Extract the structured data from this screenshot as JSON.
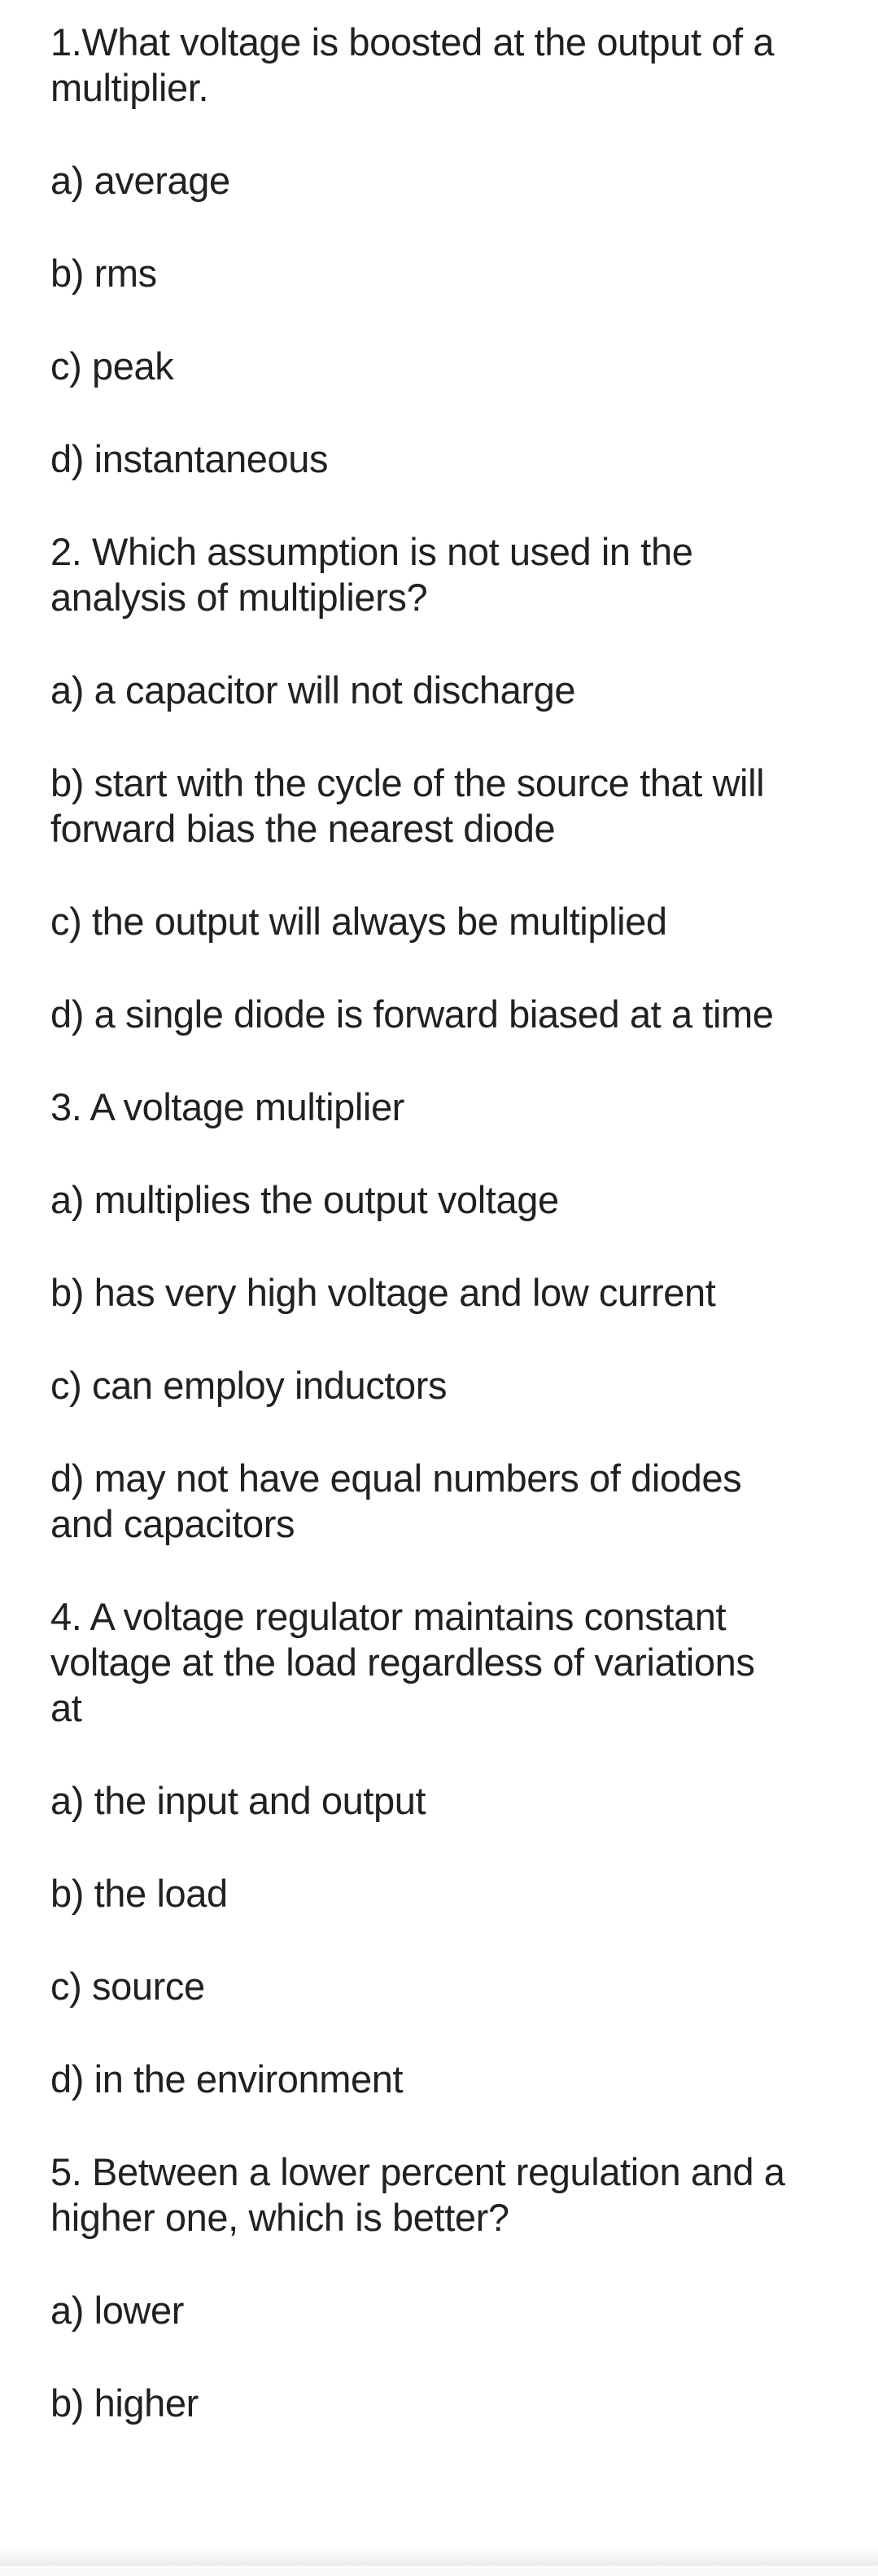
{
  "questions": [
    {
      "number": "1",
      "question_lines": [
        "1.What voltage is boosted at the output of a",
        "multiplier."
      ],
      "options": [
        {
          "letter": "a",
          "lines": [
            "a) average"
          ]
        },
        {
          "letter": "b",
          "lines": [
            "b) rms"
          ]
        },
        {
          "letter": "c",
          "lines": [
            "c) peak"
          ]
        },
        {
          "letter": "d",
          "lines": [
            "d) instantaneous"
          ]
        }
      ]
    },
    {
      "number": "2",
      "question_lines": [
        "2. Which assumption is not used in the",
        "analysis of multipliers?"
      ],
      "options": [
        {
          "letter": "a",
          "lines": [
            "a) a capacitor will not discharge"
          ]
        },
        {
          "letter": "b",
          "lines": [
            "b) start with the cycle of the source that will",
            "forward bias the nearest diode"
          ]
        },
        {
          "letter": "c",
          "lines": [
            "c) the output will always be multiplied"
          ]
        },
        {
          "letter": "d",
          "lines": [
            "d) a single diode is forward biased at a time"
          ]
        }
      ]
    },
    {
      "number": "3",
      "question_lines": [
        "3. A voltage multiplier"
      ],
      "options": [
        {
          "letter": "a",
          "lines": [
            "a) multiplies the output voltage"
          ]
        },
        {
          "letter": "b",
          "lines": [
            "b) has very high voltage and low current"
          ]
        },
        {
          "letter": "c",
          "lines": [
            "c) can employ inductors"
          ]
        },
        {
          "letter": "d",
          "lines": [
            "d) may not have equal numbers of diodes",
            "and capacitors"
          ]
        }
      ]
    },
    {
      "number": "4",
      "question_lines": [
        "4. A voltage regulator maintains constant",
        "voltage at the load regardless of variations",
        "at"
      ],
      "options": [
        {
          "letter": "a",
          "lines": [
            "a) the input and output"
          ]
        },
        {
          "letter": "b",
          "lines": [
            "b) the load"
          ]
        },
        {
          "letter": "c",
          "lines": [
            "c) source"
          ]
        },
        {
          "letter": "d",
          "lines": [
            "d) in the environment"
          ]
        }
      ]
    },
    {
      "number": "5",
      "question_lines": [
        "5. Between a lower percent regulation and a",
        "higher one, which is better?"
      ],
      "options": [
        {
          "letter": "a",
          "lines": [
            "a) lower"
          ]
        },
        {
          "letter": "b",
          "lines": [
            "b) higher"
          ]
        }
      ]
    }
  ]
}
